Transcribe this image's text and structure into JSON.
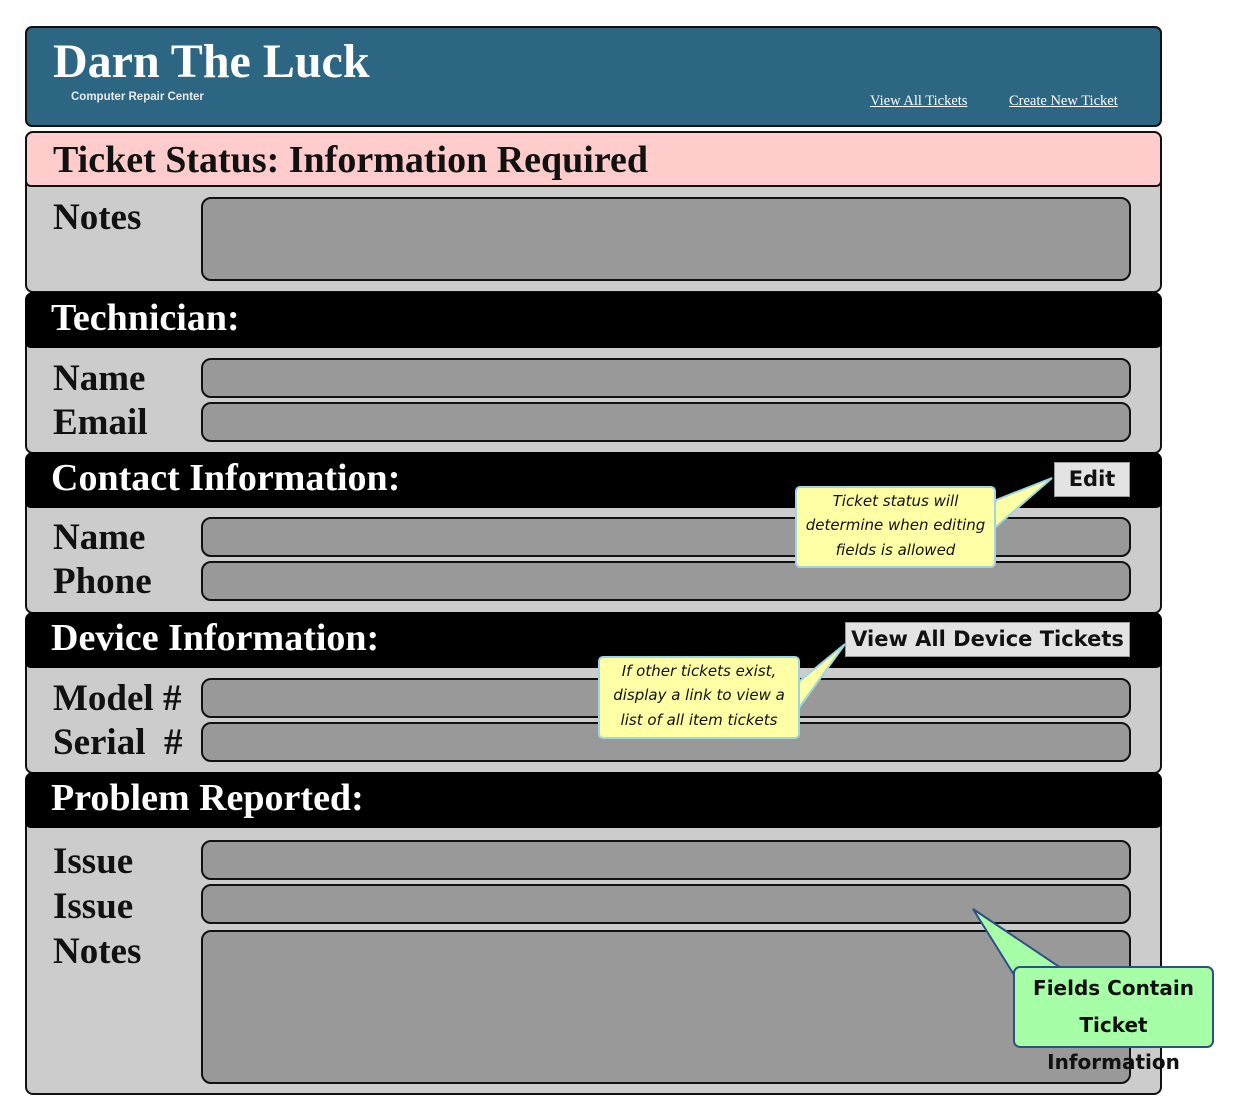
{
  "header": {
    "title": "Darn The Luck",
    "subtitle": "Computer Repair Center",
    "nav": {
      "view_all_tickets": "View All Tickets",
      "create_new_ticket": "Create New Ticket"
    }
  },
  "status": {
    "title": "Ticket Status: Information Required",
    "notes_label": "Notes"
  },
  "technician": {
    "title": "Technician:",
    "name_label": "Name",
    "email_label": "Email"
  },
  "contact": {
    "title": "Contact Information:",
    "edit_button": "Edit",
    "name_label": "Name",
    "phone_label": "Phone"
  },
  "device": {
    "title": "Device Information:",
    "view_device_tickets_button": "View All Device Tickets",
    "model_label": "Model #",
    "serial_label": "Serial  #"
  },
  "problem": {
    "title": "Problem Reported:",
    "issue_label_1": "Issue",
    "issue_label_2": "Issue",
    "notes_label": "Notes"
  },
  "annotations": {
    "edit_note": "Ticket status will determine when editing fields is allowed",
    "device_note": "If other tickets exist, display a link to view a list of all item tickets",
    "fields_note": "Fields Contain Ticket Information"
  },
  "colors": {
    "header_bg": "#2d6682",
    "status_bg": "#ffcccc",
    "section_head_bg": "#000000",
    "section_body_bg": "#cccccc",
    "field_bg": "#999999",
    "note_yellow": "#ffffa5",
    "note_green": "#a6ffa6"
  }
}
